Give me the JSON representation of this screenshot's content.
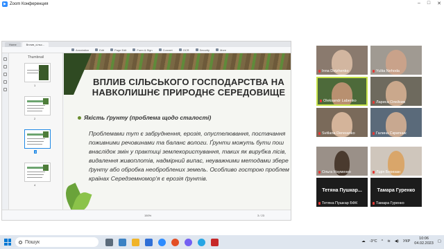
{
  "window": {
    "title": "Zoom Конференция"
  },
  "pdf_viewer": {
    "tabs": [
      "Home",
      "Вплив_сільс..."
    ],
    "toolbar": [
      "Annotation",
      "Edit",
      "Page Edit",
      "Form & Sign",
      "Convert",
      "OCR",
      "Security",
      "More"
    ],
    "thumbnails_header": "Thumbnail",
    "thumb_numbers": [
      "1",
      "2",
      "3",
      "4"
    ],
    "zoom_level": "150%",
    "page_indicator": "3 / 23"
  },
  "slide": {
    "title_line1": "ВПЛИВ СІЛЬСЬКОГО ГОСПОДАРСТВА НА",
    "title_line2": "НАВКОЛИШНЄ ПРИРОДНЄ СЕРЕДОВИЩЕ",
    "bullet": "Якість ґрунту (проблема щодо сталості)",
    "body_lines": [
      "Проблемами тут є забруднення, ерозія, опустелювання, постачання",
      "поживними речовинами та баланс вологи. Ґрунти можуть бути пош",
      "внаслідок змін у практиці землекористування, таких як вирубка лісів,",
      "видалення живоплотів, надмірний випас, неуважними методами збере",
      "ґрунту або обробка необроблених земель. Особливо гострою проблем",
      "країнах Середземномор'я є ерозія ґрунтів."
    ]
  },
  "participants": [
    {
      "name": "Inna Dotzhenko",
      "muted": true
    },
    {
      "name": "Yuliia Nehoda",
      "muted": true
    },
    {
      "name": "Oleksandr Labenko",
      "muted": true
    },
    {
      "name": "Лариса Олейник",
      "muted": true
    },
    {
      "name": "Svitlana Deresanko",
      "muted": true
    },
    {
      "name": "Галина Скрипник",
      "muted": true
    },
    {
      "name": "Ольга Науменко",
      "muted": true
    },
    {
      "name": "Лідія Березан",
      "muted": true
    },
    {
      "name": "Тетяна Пушкар БФК",
      "display": "Тетяна Пушкар...",
      "muted": true
    },
    {
      "name": "Тамара Гуренко",
      "display": "Тамара Гуренко",
      "muted": true
    }
  ],
  "taskbar": {
    "search_placeholder": "Пошук",
    "weather": "-3°C",
    "language": "УКР",
    "time": "10:06",
    "date": "04.02.2023"
  }
}
